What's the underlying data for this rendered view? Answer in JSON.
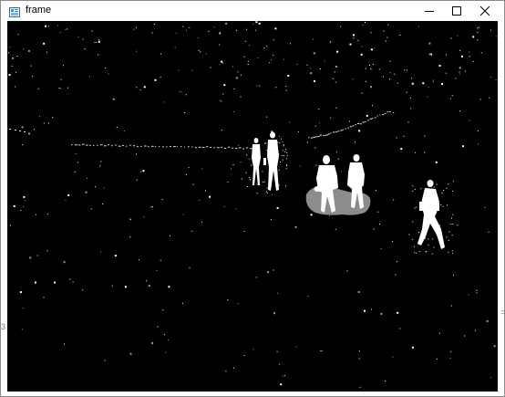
{
  "window": {
    "title": "frame",
    "minimize_glyph": "minimize-icon",
    "maximize_glyph": "maximize-icon",
    "close_glyph": "close-icon",
    "left_edge_text": "3",
    "right_edge_text": "="
  },
  "frame_view": {
    "description_icon": "image-frame",
    "background_color": "#000000",
    "foreground_color": "#ffffff",
    "shadow_color": "#8c8c8c"
  }
}
